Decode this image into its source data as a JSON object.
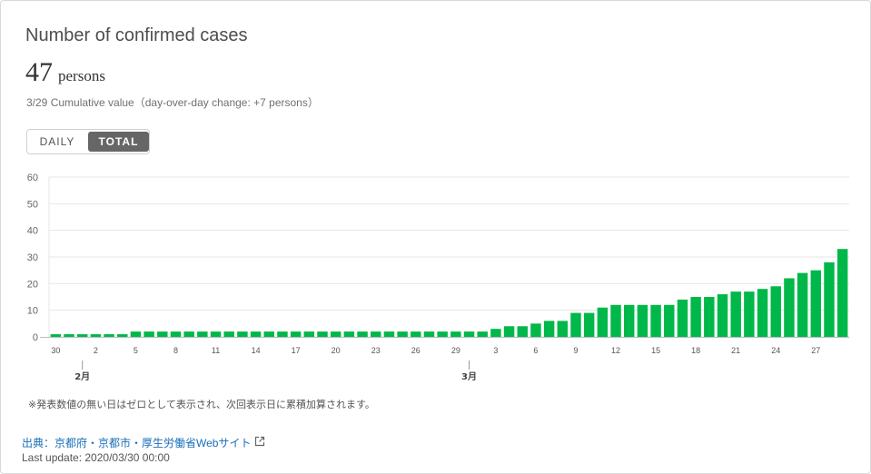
{
  "card": {
    "title": "Number of confirmed cases",
    "value": "47",
    "unit": "persons",
    "description": "3/29 Cumulative value（day-over-day change: +7 persons）"
  },
  "toggle": {
    "daily_label": "DAILY",
    "total_label": "TOTAL",
    "selected": "TOTAL"
  },
  "note": "※発表数値の無い日はゼロとして表示され、次回表示日に累積加算されます。",
  "source_link": "出典：京都府・京都市・厚生労働省Webサイト",
  "last_updated": "Last update: 2020/03/30 00:00",
  "colors": {
    "bar": "#00b849",
    "grid": "#e6e6e6",
    "axis": "#999999"
  },
  "chart_data": {
    "type": "bar",
    "title": "",
    "xlabel": "",
    "ylabel": "",
    "ylim": [
      0,
      60
    ],
    "yticks": [
      0,
      10,
      20,
      30,
      40,
      50,
      60
    ],
    "grid": true,
    "dates": [
      "1/30",
      "1/31",
      "2/1",
      "2/2",
      "2/3",
      "2/4",
      "2/5",
      "2/6",
      "2/7",
      "2/8",
      "2/9",
      "2/10",
      "2/11",
      "2/12",
      "2/13",
      "2/14",
      "2/15",
      "2/16",
      "2/17",
      "2/18",
      "2/19",
      "2/20",
      "2/21",
      "2/22",
      "2/23",
      "2/24",
      "2/25",
      "2/26",
      "2/27",
      "2/28",
      "2/29",
      "3/1",
      "3/2",
      "3/3",
      "3/4",
      "3/5",
      "3/6",
      "3/7",
      "3/8",
      "3/9",
      "3/10",
      "3/11",
      "3/12",
      "3/13",
      "3/14",
      "3/15",
      "3/16",
      "3/17",
      "3/18",
      "3/19",
      "3/20",
      "3/21",
      "3/22",
      "3/23",
      "3/24",
      "3/25",
      "3/26",
      "3/27",
      "3/28",
      "3/29"
    ],
    "values": [
      1,
      1,
      1,
      1,
      1,
      1,
      2,
      2,
      2,
      2,
      2,
      2,
      2,
      2,
      2,
      2,
      2,
      2,
      2,
      2,
      2,
      2,
      2,
      2,
      2,
      2,
      2,
      2,
      2,
      2,
      2,
      2,
      2,
      3,
      4,
      4,
      5,
      6,
      6,
      9,
      9,
      11,
      12,
      12,
      12,
      12,
      12,
      14,
      15,
      15,
      16,
      17,
      17,
      18,
      19,
      22,
      24,
      25,
      28,
      33
    ],
    "x_tick_labels": [
      {
        "date": "1/30",
        "label": "30"
      },
      {
        "date": "2/2",
        "label": "2"
      },
      {
        "date": "2/5",
        "label": "5"
      },
      {
        "date": "2/8",
        "label": "8"
      },
      {
        "date": "2/11",
        "label": "11"
      },
      {
        "date": "2/14",
        "label": "14"
      },
      {
        "date": "2/17",
        "label": "17"
      },
      {
        "date": "2/20",
        "label": "20"
      },
      {
        "date": "2/23",
        "label": "23"
      },
      {
        "date": "2/26",
        "label": "26"
      },
      {
        "date": "2/29",
        "label": "29"
      },
      {
        "date": "3/3",
        "label": "3"
      },
      {
        "date": "3/6",
        "label": "6"
      },
      {
        "date": "3/9",
        "label": "9"
      },
      {
        "date": "3/12",
        "label": "12"
      },
      {
        "date": "3/15",
        "label": "15"
      },
      {
        "date": "3/18",
        "label": "18"
      },
      {
        "date": "3/21",
        "label": "21"
      },
      {
        "date": "3/24",
        "label": "24"
      },
      {
        "date": "3/27",
        "label": "27"
      }
    ],
    "month_labels": [
      {
        "date": "2/1",
        "label": "2月"
      },
      {
        "date": "3/1",
        "label": "3月"
      }
    ]
  }
}
